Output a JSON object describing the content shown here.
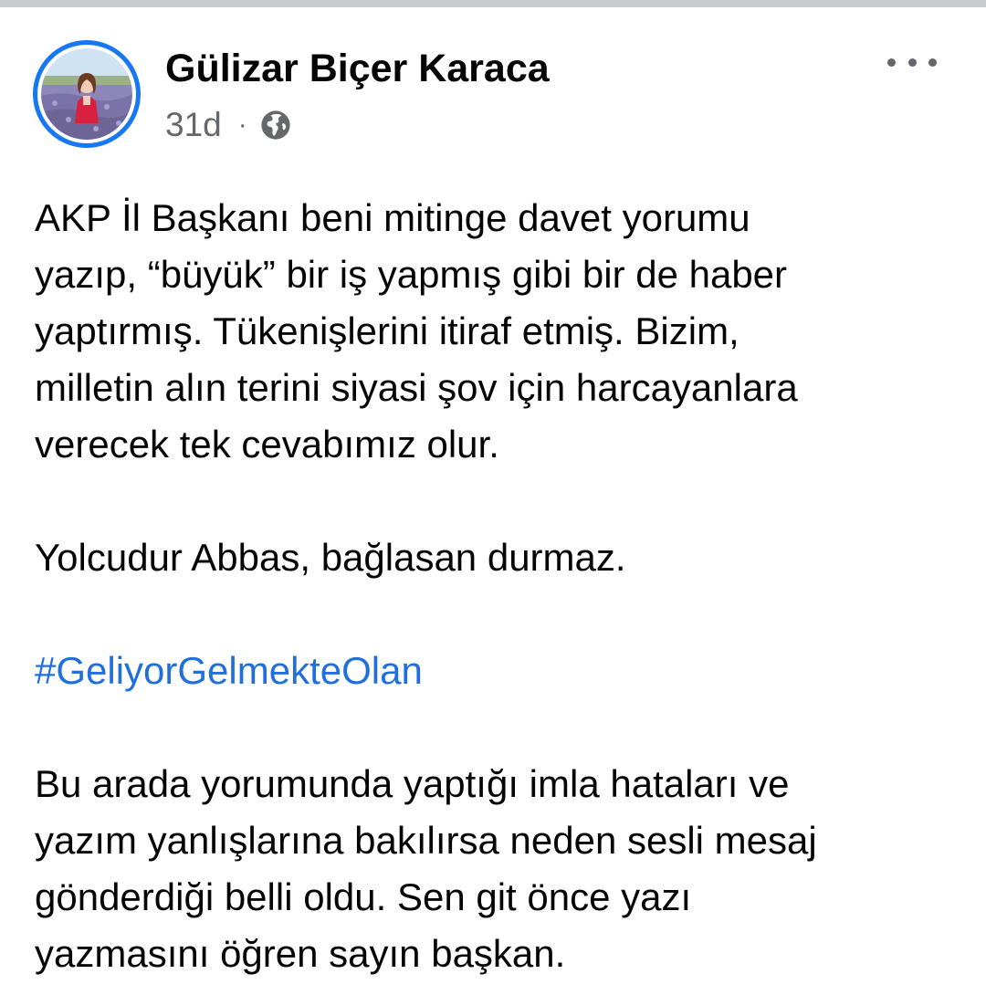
{
  "post": {
    "author": {
      "name": "Gülizar Biçer Karaca",
      "avatar": "profile-photo-lavender-field"
    },
    "meta": {
      "time": "31d",
      "separator": "·",
      "audience_icon": "globe-icon"
    },
    "more_icon": "ellipsis-icon",
    "body": {
      "paragraph1": [
        "AKP İl Başkanı beni mitinge davet yorumu",
        "yazıp, “büyük” bir iş yapmış gibi bir de haber",
        "yaptırmış. Tükenişlerini itiraf etmiş. Bizim,",
        "milletin alın terini siyasi şov için harcayanlara",
        "verecek tek cevabımız olur."
      ],
      "paragraph2": "Yolcudur Abbas, bağlasan durmaz.",
      "hashtag": "#GeliyorGelmekteOlan",
      "paragraph3": [
        "Bu arada yorumunda yaptığı imla hataları ve",
        "yazım yanlışlarına bakılırsa neden sesli mesaj",
        "gönderdiği belli oldu. Sen git önce yazı",
        "yazmasını öğren sayın başkan."
      ]
    },
    "colors": {
      "link": "#216fdb",
      "story_ring": "#1877f2",
      "secondary_text": "#65676b"
    }
  }
}
